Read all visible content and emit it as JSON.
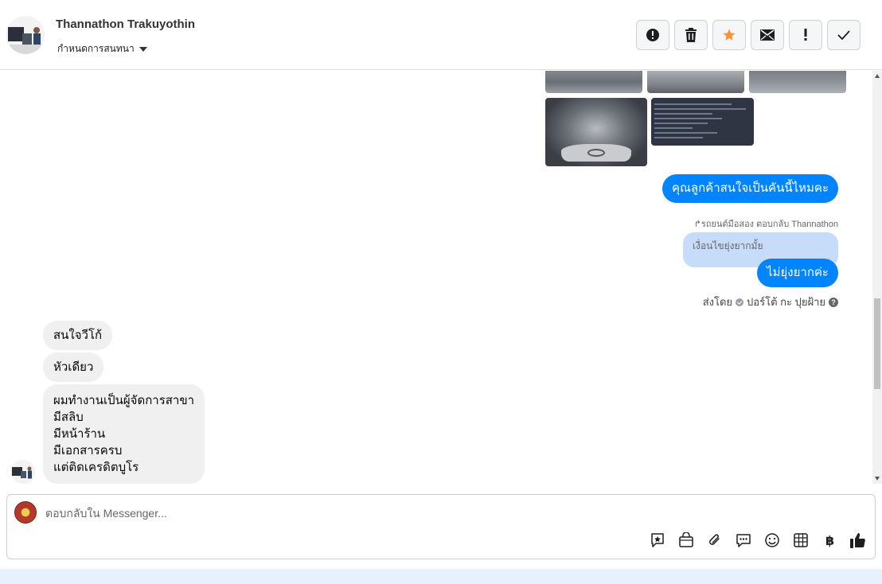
{
  "header": {
    "contact_name": "Thannathon Trakuyothin",
    "assign_label": "กำหนดการสนทนา"
  },
  "toolbar": {
    "buttons": [
      {
        "icon": "alert-circle-icon"
      },
      {
        "icon": "trash-icon"
      },
      {
        "icon": "star-icon",
        "color": "#f7923a"
      },
      {
        "icon": "envelope-icon"
      },
      {
        "icon": "exclamation-icon"
      },
      {
        "icon": "check-icon"
      }
    ]
  },
  "messages": {
    "outgoing_1": "คุณลูกค้าสนใจเป็นคันนี้ไหมคะ",
    "reply_meta": "↱รถยนต์มือสอง ตอบกลับ Thannathon",
    "quoted_text": "เงื่อนไขยุ่งยากมั้ย",
    "outgoing_2": "ไม่ยุ่งยากค่ะ",
    "sent_by_prefix": "ส่งโดย",
    "sent_by_name": "ปอร์โต้ กะ ปุยฝ้าย",
    "incoming_1": "สนใจวีโก้",
    "incoming_2": "หัวเดียว",
    "incoming_3": [
      "ผมทำงานเป็นผู้จัดการสาขา",
      "มีสลิบ",
      "มีหน้าร้าน",
      "มีเอกสารครบ",
      "แต่ติดเครดิตบูโร"
    ]
  },
  "composer": {
    "placeholder": "ตอบกลับใน Messenger...",
    "icons": [
      "saved-reply-icon",
      "shop-bag-icon",
      "paperclip-icon",
      "chat-dots-icon",
      "emoji-icon",
      "table-icon",
      "baht-icon",
      "like-icon"
    ]
  },
  "colors": {
    "accent": "#0084ff",
    "quoted_bg": "#c7dcf9",
    "incoming_bg": "#f0f0f0"
  }
}
